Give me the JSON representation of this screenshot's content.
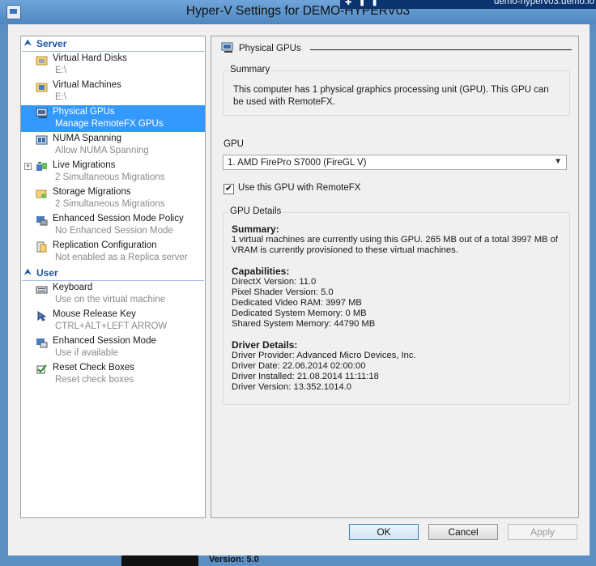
{
  "window": {
    "title": "Hyper-V Settings for DEMO-HYPERV03",
    "taskbar_text": "demo-hyperv03.demo.lo",
    "bottom_strip_text": "Version:         5.0"
  },
  "sidebar": {
    "sections": [
      {
        "label": "Server",
        "items": [
          {
            "label": "Virtual Hard Disks",
            "sub": "E:\\",
            "icon": "folder-disk-icon"
          },
          {
            "label": "Virtual Machines",
            "sub": "E:\\",
            "icon": "folder-vm-icon"
          },
          {
            "label": "Physical GPUs",
            "sub": "Manage RemoteFX GPUs",
            "icon": "gpu-icon",
            "selected": true
          },
          {
            "label": "NUMA Spanning",
            "sub": "Allow NUMA Spanning",
            "icon": "numa-icon"
          },
          {
            "label": "Live Migrations",
            "sub": "2 Simultaneous Migrations",
            "icon": "live-migration-icon",
            "expandable": true
          },
          {
            "label": "Storage Migrations",
            "sub": "2 Simultaneous Migrations",
            "icon": "storage-migration-icon"
          },
          {
            "label": "Enhanced Session Mode Policy",
            "sub": "No Enhanced Session Mode",
            "icon": "session-policy-icon"
          },
          {
            "label": "Replication Configuration",
            "sub": "Not enabled as a Replica server",
            "icon": "replication-icon"
          }
        ]
      },
      {
        "label": "User",
        "items": [
          {
            "label": "Keyboard",
            "sub": "Use on the virtual machine",
            "icon": "keyboard-icon"
          },
          {
            "label": "Mouse Release Key",
            "sub": "CTRL+ALT+LEFT ARROW",
            "icon": "mouse-icon"
          },
          {
            "label": "Enhanced Session Mode",
            "sub": "Use if available",
            "icon": "session-icon"
          },
          {
            "label": "Reset Check Boxes",
            "sub": "Reset check boxes",
            "icon": "reset-checkbox-icon"
          }
        ]
      }
    ]
  },
  "panel": {
    "title": "Physical GPUs",
    "summary": {
      "title": "Summary",
      "text": "This computer has 1 physical graphics processing unit (GPU). This GPU can be used with RemoteFX."
    },
    "gpu_label": "GPU",
    "gpu_selected": "1. AMD FirePro S7000 (FireGL V)",
    "use_gpu_checkbox": {
      "label": "Use this GPU with RemoteFX",
      "checked": true
    },
    "details": {
      "title": "GPU Details",
      "summary_heading": "Summary:",
      "summary_text": "1 virtual machines are currently using this GPU. 265 MB out of a total 3997 MB of VRAM is currently provisioned to these virtual machines.",
      "capabilities_heading": "Capabilities:",
      "capabilities": [
        "DirectX Version: 11.0",
        "Pixel Shader Version: 5.0",
        "Dedicated Video RAM: 3997 MB",
        "Dedicated System Memory: 0 MB",
        "Shared System Memory: 44790 MB"
      ],
      "driver_heading": "Driver Details:",
      "driver": [
        "Driver Provider: Advanced Micro Devices, Inc.",
        "Driver Date: 22.06.2014 02:00:00",
        "Driver Installed: 21.08.2014 11:11:18",
        "Driver Version: 13.352.1014.0"
      ]
    }
  },
  "buttons": {
    "ok": "OK",
    "cancel": "Cancel",
    "apply": "Apply"
  }
}
